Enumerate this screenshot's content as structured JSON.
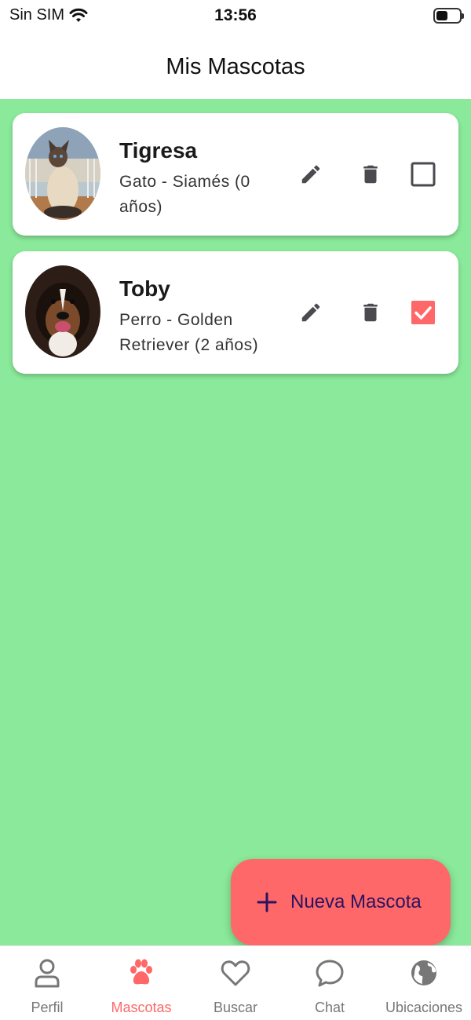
{
  "status_bar": {
    "carrier": "Sin SIM",
    "time": "13:56"
  },
  "header": {
    "title": "Mis Mascotas"
  },
  "colors": {
    "background": "#8ae99a",
    "accent": "#fe6868",
    "fab_text": "#2a1460",
    "icon": "#4a4a4f"
  },
  "pets": [
    {
      "name": "Tigresa",
      "description": "Gato - Siamés (0 años)",
      "avatar": "siamese-cat-photo",
      "selected": false
    },
    {
      "name": "Toby",
      "description": "Perro - Golden Retriever (2 años)",
      "avatar": "dog-photo",
      "selected": true
    }
  ],
  "fab": {
    "icon": "plus-icon",
    "label": "Nueva Mascota"
  },
  "bottom_nav": [
    {
      "label": "Perfil",
      "icon": "person-icon",
      "active": false
    },
    {
      "label": "Mascotas",
      "icon": "paw-icon",
      "active": true
    },
    {
      "label": "Buscar",
      "icon": "heart-icon",
      "active": false
    },
    {
      "label": "Chat",
      "icon": "chat-bubble-icon",
      "active": false
    },
    {
      "label": "Ubicaciones",
      "icon": "globe-icon",
      "active": false
    }
  ]
}
